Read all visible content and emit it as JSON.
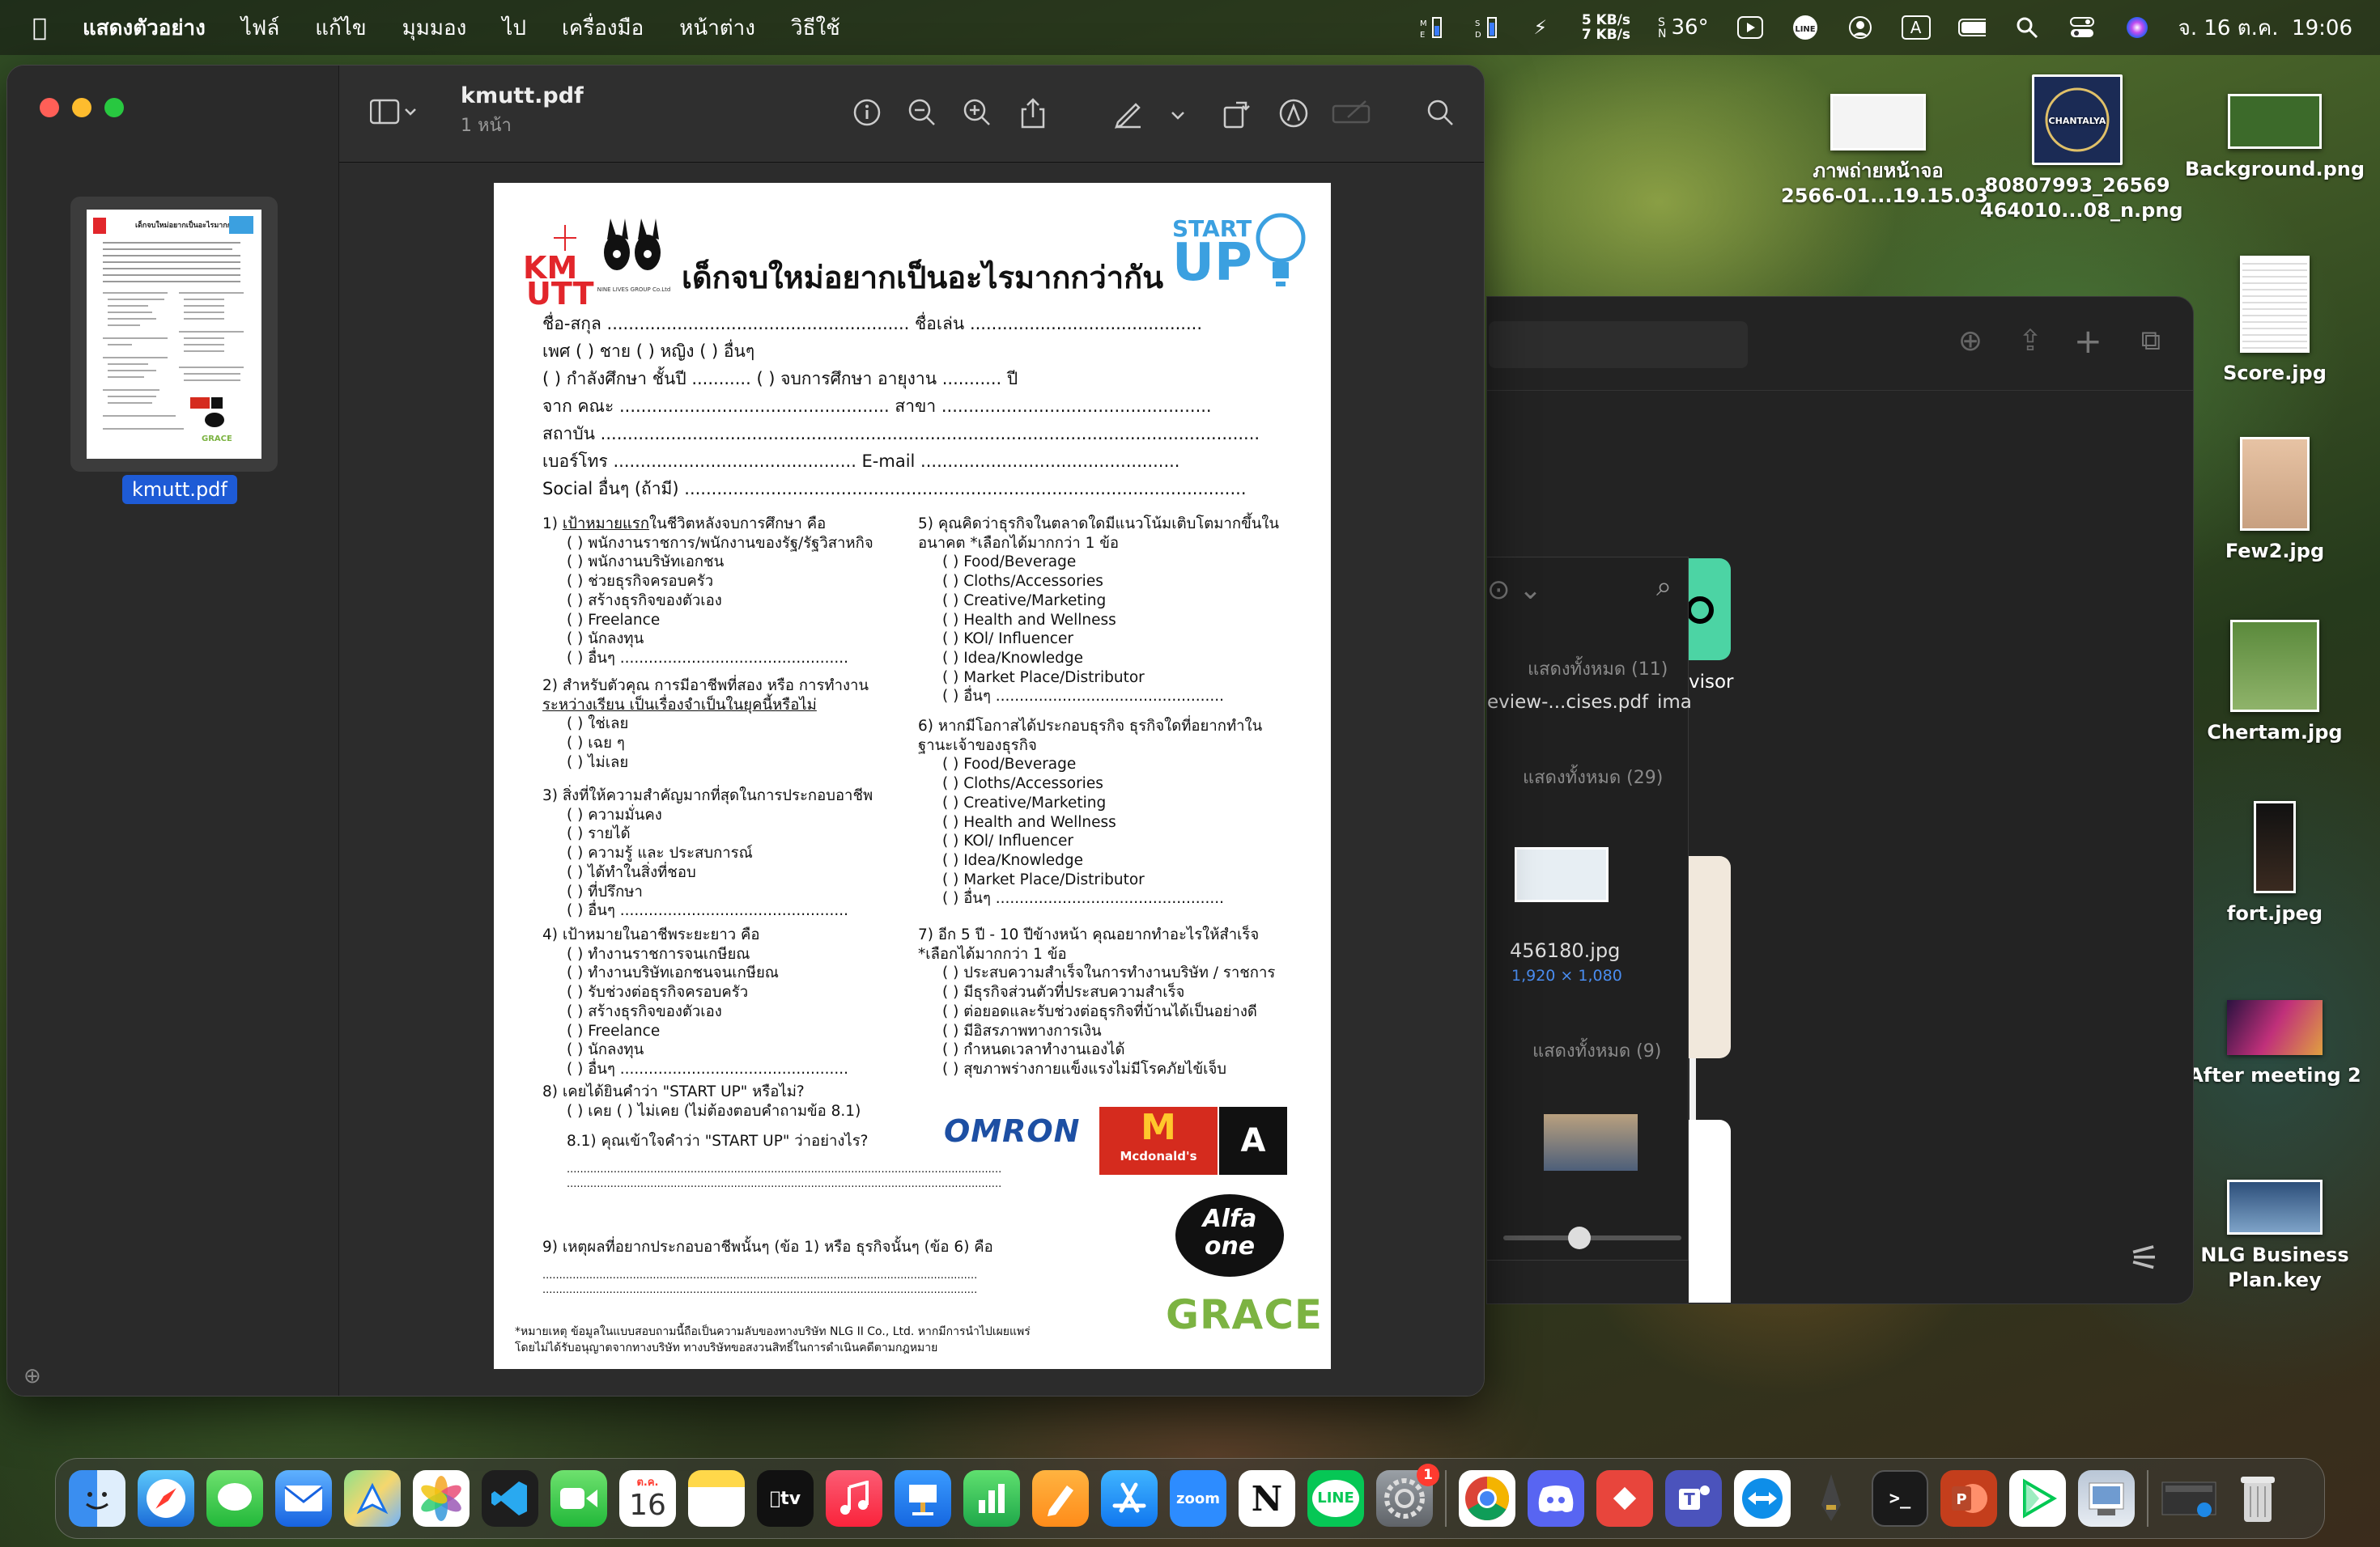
{
  "menubar": {
    "apple": "",
    "app_name": "แสดงตัวอย่าง",
    "menus": [
      "ไฟล์",
      "แก้ไข",
      "มุมมอง",
      "ไป",
      "เครื่องมือ",
      "หน้าต่าง",
      "วิธีใช้"
    ],
    "net_up": "5 KB/s",
    "net_down": "7 KB/s",
    "temp": "36°",
    "input_source": "A",
    "datetime": "จ. 16 ต.ค.  19:06"
  },
  "window": {
    "title": "kmutt.pdf",
    "subtitle": "1 หน้า",
    "thumb_label": "kmutt.pdf"
  },
  "doc": {
    "title": "เด็กจบใหม่อยากเป็นอะไรมากกว่ากัน",
    "logo_kmutt": "KMUTT",
    "logo_nine": "NINE LIVES GROUP Co.Ltd",
    "logo_start": "START",
    "logo_up": "UP",
    "fields": [
      "ชื่อ-สกุล ........................................................ ชื่อเล่น ...........................................",
      "เพศ ( ) ชาย      ( ) หญิง      ( ) อื่นๆ",
      "( ) กำลังศึกษา ชั้นปี ........... ( ) จบการศึกษา อายุงาน ........... ปี",
      "จาก คณะ .................................................. สาขา ..................................................",
      "สถาบัน ..........................................................................................................................",
      "เบอร์โทร ............................................. E-mail ................................................",
      "Social อื่นๆ (ถ้ามี) ........................................................................................................"
    ],
    "q1": {
      "num": "1)",
      "title_pre": "",
      "title_u": "เป้าหมายแรก",
      "title_post": "ในชีวิตหลังจบการศึกษา คือ",
      "opts": [
        "( ) พนักงานราชการ/พนักงานของรัฐ/รัฐวิสาหกิจ",
        "( ) พนักงานบริษัทเอกชน",
        "( ) ช่วยธุรกิจครอบครัว",
        "( ) สร้างธุรกิจของตัวเอง",
        "( ) Freelance",
        "( ) นักลงทุน",
        "( ) อื่นๆ ................................................"
      ]
    },
    "q2": {
      "line1": "2) สำหรับตัวคุณ การมีอาชีพที่สอง หรือ การทำงาน",
      "line2": "ระหว่างเรียน เป็นเรื่องจำเป็นในยุคนี้หรือไม่",
      "opts": [
        "( ) ใช่เลย",
        "( ) เฉย ๆ",
        "( ) ไม่เลย"
      ]
    },
    "q3": {
      "line1": "3) สิ่งที่ให้ความสำคัญมากที่สุดในการประกอบอาชีพ",
      "opts": [
        "( ) ความมั่นคง",
        "( ) รายได้",
        "( ) ความรู้ และ ประสบการณ์",
        "( ) ได้ทำในสิ่งที่ชอบ",
        "( ) ที่ปรึกษา",
        "( ) อื่นๆ ................................................"
      ]
    },
    "q4": {
      "line1": "4) เป้าหมายในอาชีพระยะยาว คือ",
      "opts": [
        "( ) ทำงานราชการจนเกษียณ",
        "( ) ทำงานบริษัทเอกชนจนเกษียณ",
        "( ) รับช่วงต่อธุรกิจครอบครัว",
        "( ) สร้างธุรกิจของตัวเอง",
        "( ) Freelance",
        "( ) นักลงทุน",
        "( ) อื่นๆ ................................................"
      ]
    },
    "q5": {
      "line1": "5) คุณคิดว่าธุรกิจในตลาดใดมีแนวโน้มเติบโตมากขึ้นใน",
      "line2": "อนาคต *เลือกได้มากกว่า 1 ข้อ",
      "opts": [
        "( ) Food/Beverage",
        "( ) Cloths/Accessories",
        "( ) Creative/Marketing",
        "( ) Health and Wellness",
        "( ) KOl/ Influencer",
        "( ) Idea/Knowledge",
        "( ) Market Place/Distributor",
        "( ) อื่นๆ ................................................"
      ]
    },
    "q6": {
      "line1": "6) หากมีโอกาสได้ประกอบธุรกิจ ธุรกิจใดที่อยากทำใน",
      "line2": "ฐานะเจ้าของธุรกิจ",
      "opts": [
        "( ) Food/Beverage",
        "( ) Cloths/Accessories",
        "( ) Creative/Marketing",
        "( ) Health and Wellness",
        "( ) KOl/ Influencer",
        "( ) Idea/Knowledge",
        "( ) Market Place/Distributor",
        "( ) อื่นๆ ................................................"
      ]
    },
    "q7": {
      "line1": "7) อีก 5 ปี - 10 ปีข้างหน้า คุณอยากทำอะไรให้สำเร็จ",
      "line2": "*เลือกได้มากกว่า 1 ข้อ",
      "opts": [
        "( ) ประสบความสำเร็จในการทำงานบริษัท / ราชการ",
        "( ) มีธุรกิจส่วนตัวที่ประสบความสำเร็จ",
        "( ) ต่อยอดและรับช่วงต่อธุรกิจที่บ้านได้เป็นอย่างดี",
        "( ) มีอิสรภาพทางการเงิน",
        "( ) กำหนดเวลาทำงานเองได้",
        "( ) สุขภาพร่างกายแข็งแรงไม่มีโรคภัยไข้เจ็บ"
      ]
    },
    "q8": {
      "line1": "8) เคยได้ยินคำว่า \"START UP\" หรือไม่?",
      "line2": "( ) เคย     ( ) ไม่เคย (ไม่ต้องตอบคำถามข้อ 8.1)",
      "line3": "8.1) คุณเข้าใจคำว่า \"START UP\" ว่าอย่างไร?",
      "dots": ".................................................................................................................................."
    },
    "q9": {
      "line1": "9) เหตุผลที่อยากประกอบอาชีพนั้นๆ (ข้อ 1) หรือ ธุรกิจนั้นๆ (ข้อ 6) คือ",
      "dots": ".................................................................................................................................."
    },
    "sponsors": {
      "omron": "OMRON",
      "mcd_m": "M",
      "mcd": "Mcdonald's",
      "a": "A",
      "alfa1": "Alfa",
      "alfa2": "one",
      "grace": "GRACE"
    },
    "note1": "*หมายเหตุ ข้อมูลในแบบสอบถามนี้ถือเป็นความลับของทางบริษัท NLG II Co., Ltd. หากมีการนำไปเผยแพร่",
    "note2": "โดยไม่ได้รับอนุญาตจากทางบริษัท ทางบริษัทขอสงวนสิทธิ์ในการดำเนินคดีตามกฎหมาย"
  },
  "finder": {
    "show_all_11": "แสดงทั้งหมด (11)",
    "file_review": "eview-...cises.pdf",
    "file_ima": "ima",
    "show_all_29": "แสดงทั้งหมด (29)",
    "img_name": "456180.jpg",
    "img_dims": "1,920 × 1,080",
    "show_all_9": "แสดงทั้งหมด (9)",
    "advisor": "visor"
  },
  "desktop": [
    {
      "label": "ภาพถ่ายหน้าจอ\n2566-01...19.15.03"
    },
    {
      "label": "80807993_26569\n464010...08_n.png"
    },
    {
      "label": "Background.png"
    },
    {
      "label": "Score.jpg"
    },
    {
      "label": "Few2.jpg"
    },
    {
      "label": "Chertam.jpg"
    },
    {
      "label": "fort.jpeg"
    },
    {
      "label": "After meeting 2"
    },
    {
      "label": "NLG Business\nPlan.key"
    }
  ],
  "dock": {
    "calendar_month": "ต.ค.",
    "calendar_day": "16",
    "zoom": "zoom",
    "notion": "N",
    "line": "LINE",
    "badge": "1",
    "tv": "tv"
  }
}
